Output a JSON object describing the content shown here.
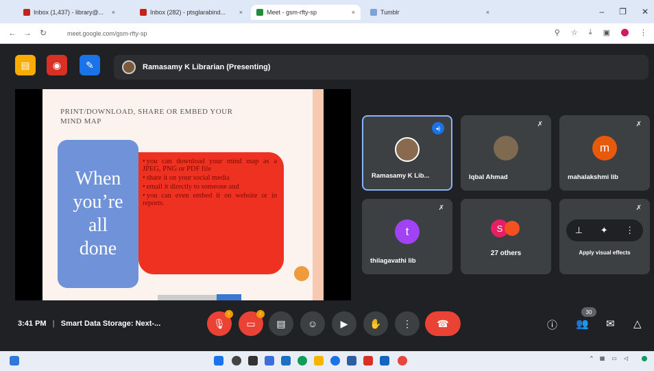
{
  "browser": {
    "tabs": [
      {
        "label": "Inbox (1,437) - library@...",
        "fav_color": "#c5221f"
      },
      {
        "label": "Inbox (282) - ptsglarabind...",
        "fav_color": "#c5221f"
      },
      {
        "label": "Meet - gsm-rfty-sp",
        "fav_color": "#1e8e3e",
        "active": true
      },
      {
        "label": "Tumblr",
        "fav_color": "#7aa2d6"
      }
    ],
    "url": "meet.google.com/gsm-rfty-sp"
  },
  "meet": {
    "presenter_text": "Ramasamy K Librarian (Presenting)",
    "slide": {
      "title_line1": "Print/Download, share or embed your",
      "title_line2": "mind map",
      "blue_text_1": "When",
      "blue_text_2": "you’re",
      "blue_text_3": "all",
      "blue_text_4": "done",
      "bullets": [
        "you can download your mind map as a JPEG, PNG or PDF file",
        "share it on your social media",
        "email it directly to someone and",
        "you can even embed it on website or in reports."
      ]
    },
    "tiles": {
      "t1_name": "Ramasamy K Lib...",
      "t2_name": "Iqbal Ahmad",
      "t3_name": "mahalakshmi lib",
      "t3_initial": "m",
      "t4_name": "thilagavathi lib",
      "t4_initial": "t",
      "others_count": "27 others",
      "effects_label": "Apply visual effects"
    },
    "bottom": {
      "time": "3:41 PM",
      "meeting_title": "Smart Data Storage: Next-...",
      "participants_count": "30"
    }
  },
  "colors": {
    "accent_blue": "#1a73e8",
    "leave_red": "#ea4335",
    "slide_red": "#ee3121",
    "slide_blue": "#6f92d8"
  }
}
